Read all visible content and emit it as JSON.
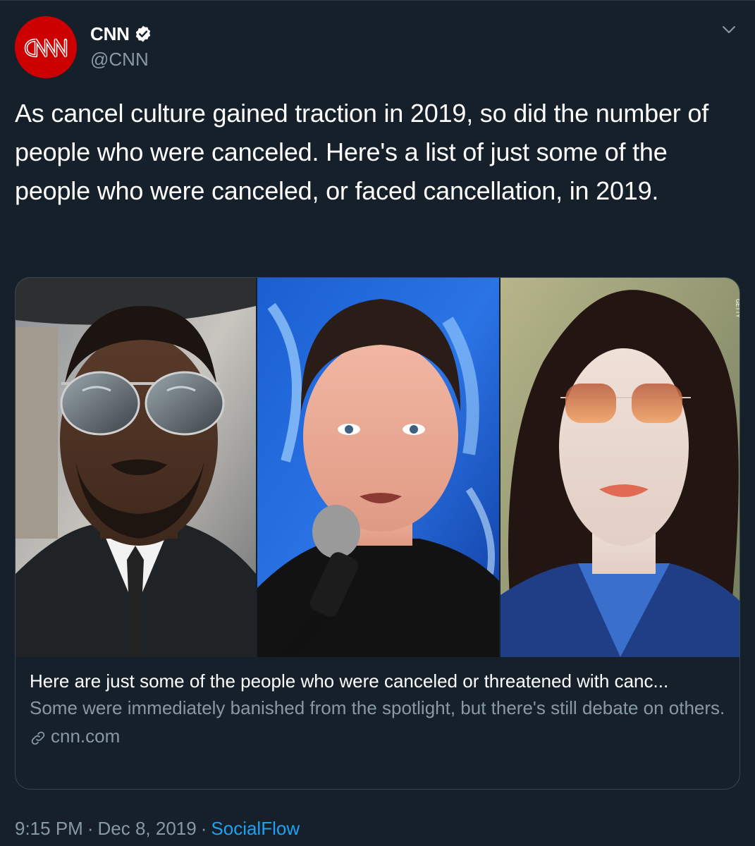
{
  "author": {
    "display_name": "CNN",
    "handle": "@CNN",
    "avatar_logo_text": "CNN",
    "verified": true
  },
  "tweet": {
    "text": "As cancel culture gained traction in 2019, so did the number of people who were canceled. Here's a list of just some of the people who were canceled, or faced cancellation, in 2019."
  },
  "card": {
    "photos": [
      "person-1",
      "person-2",
      "person-3"
    ],
    "photo_credit": "GETTY",
    "title": "Here are just some of the people who were canceled or threatened with canc...",
    "description": "Some were immediately banished from the spotlight, but there's still debate on others.",
    "domain": "cnn.com"
  },
  "meta": {
    "time": "9:15 PM",
    "date": "Dec 8, 2019",
    "separator": "·",
    "source": "SocialFlow"
  },
  "colors": {
    "background": "#15202b",
    "border": "#38444d",
    "secondary_text": "#8899a6",
    "accent": "#1da1f2",
    "cnn_red": "#cc0000"
  },
  "icons": {
    "caret": "chevron-down-icon",
    "verified": "verified-badge-icon",
    "link": "link-icon"
  }
}
